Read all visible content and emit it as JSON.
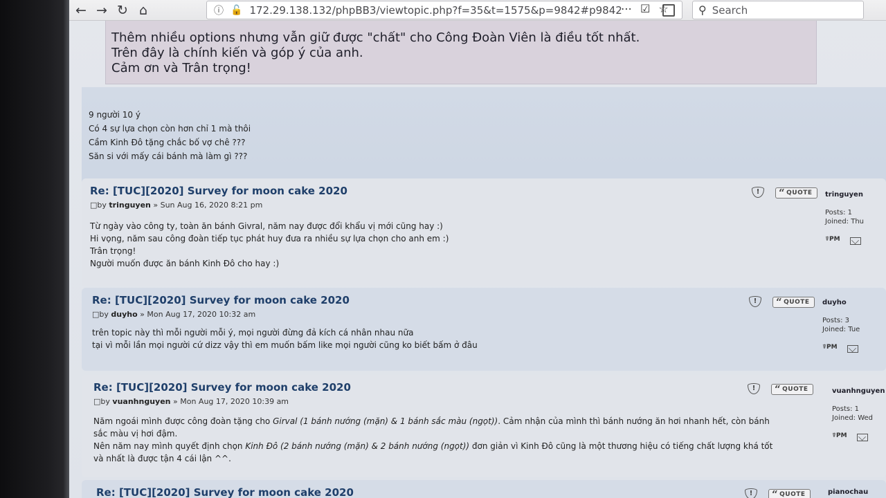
{
  "browser": {
    "url": "172.29.138.132/phpBB3/viewtopic.php?f=35&t=1575&p=9842#p9842",
    "search_placeholder": "Search"
  },
  "quote": {
    "lines": [
      "Thêm nhiều options nhưng vẫn giữ được \"chất\" cho Công Đoàn Viên là điều tốt nhất.",
      "Trên đây là chính kiến và góp ý của anh.",
      "Cảm ơn và Trân trọng!"
    ]
  },
  "first_post": {
    "lines": [
      "9 người 10 ý",
      "Có 4 sự lựa chọn còn hơn chỉ 1 mà thôi",
      "Cầm Kinh Đô tặng chắc bố vợ chê ???",
      "Săn si với mấy cái bánh mà làm gì ???"
    ]
  },
  "posts": [
    {
      "title": "Re: [TUC][2020] Survey for moon cake 2020",
      "by": "by",
      "author": "tringuyen",
      "date": "» Sun Aug 16, 2020 8:21 pm",
      "lines": [
        "Từ ngày vào công ty, toàn ăn bánh Givral, năm nay được đổi khẩu vị mới cũng hay :)",
        "Hi vọng, năm sau công đoàn tiếp tục phát huy đưa ra nhiều sự lựa chọn cho anh em :)",
        "Trân trọng!",
        "Người muốn được ăn bánh Kinh Đô cho hay :)"
      ],
      "profile": {
        "name": "tringuyen",
        "posts": "Posts: 1",
        "joined": "Joined: Thu"
      },
      "quote_label": "QUOTE"
    },
    {
      "title": "Re: [TUC][2020] Survey for moon cake 2020",
      "by": "by",
      "author": "duyho",
      "date": "» Mon Aug 17, 2020 10:32 am",
      "lines": [
        "trên topic này thì mỗi người mỗi ý, mọi người đừng đả kích cá nhân nhau nữa",
        "tại vì mỗi lần mọi người cứ dizz vậy thì em muốn bấm like mọi người cũng ko biết bấm ở đâu"
      ],
      "profile": {
        "name": "duyho",
        "posts": "Posts: 3",
        "joined": "Joined: Tue"
      },
      "quote_label": "QUOTE"
    },
    {
      "title": "Re: [TUC][2020] Survey for moon cake 2020",
      "by": "by",
      "author": "vuanhnguyen",
      "date": "» Mon Aug 17, 2020 10:39 am",
      "line1_a": "Năm ngoái mình được công đoàn tặng cho ",
      "line1_i": "Girval (1 bánh nướng (mặn) & 1 bánh sắc màu (ngọt))",
      "line1_b": ". Cảm nhận của mình thì bánh nướng ăn hơi nhanh hết, còn bánh",
      "line2": "sắc màu vị hơi đậm.",
      "line3_a": "Nên năm nay mình quyết định chọn ",
      "line3_i": "Kinh Đô (2 bánh nướng (mặn) & 2 bánh nướng (ngọt))",
      "line3_b": " đơn giản vì Kinh Đô cũng là một thương hiệu có tiếng chất lượng khá tốt",
      "line4": "và nhất là được tận 4 cái lận ^^.",
      "profile": {
        "name": "vuanhnguyen",
        "posts": "Posts: 1",
        "joined": "Joined: Wed"
      },
      "quote_label": "QUOTE"
    },
    {
      "title": "Re: [TUC][2020] Survey for moon cake 2020",
      "profile": {
        "name": "pianochau"
      },
      "quote_label": "QUOTE"
    }
  ],
  "icons": {
    "back": "back-arrow-icon",
    "forward": "forward-arrow-icon",
    "reload": "reload-icon",
    "home": "home-icon",
    "report": "report-icon",
    "pm": "pm-icon",
    "email": "email-icon"
  },
  "colors": {
    "post_title": "#1f3f6a",
    "post_bg_a": "#e1e4ea",
    "post_bg_b": "#d5dce7",
    "quote_bg": "#d9d2dc"
  }
}
